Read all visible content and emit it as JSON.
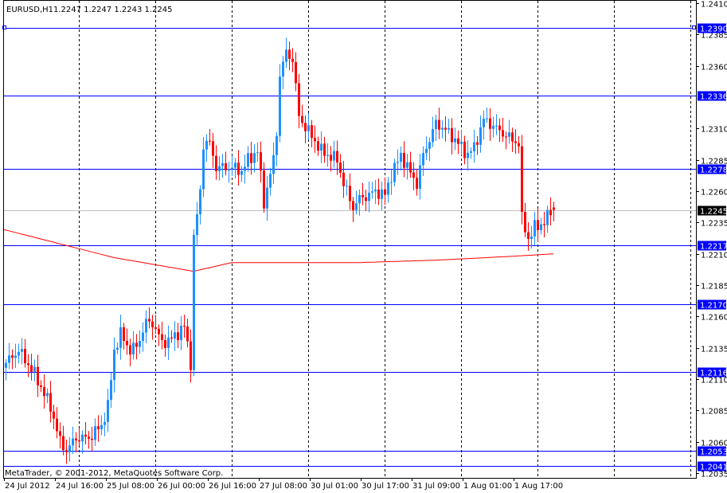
{
  "header": {
    "symbol_period": "EURUSD,H1",
    "quote": "1.2247 1.2247 1.2243 1.2245"
  },
  "copyright": "MetaTrader, © 2001-2012, MetaQuotes Software Corp.",
  "colors": {
    "bull": "#1e90ff",
    "bear": "#ff0000",
    "level_line": "#0000ff",
    "level_label_bg": "#0000ff",
    "current_line": "#c0c0c0",
    "current_label_bg": "#000000",
    "ma": "#ff0000",
    "grid": "#000000"
  },
  "chart_data": {
    "type": "candlestick",
    "title": "EURUSD,H1",
    "ylim": [
      1.2035,
      1.241
    ],
    "price_ticks": [
      "1.2410",
      "1.2385",
      "1.2360",
      "1.2310",
      "1.2285",
      "1.2260",
      "1.2235",
      "1.2210",
      "1.2185",
      "1.2160",
      "1.2135",
      "1.2110",
      "1.2085",
      "1.2060",
      "1.2035"
    ],
    "time_ticks": [
      {
        "bar": 0,
        "label": "24 Jul 2012"
      },
      {
        "bar": 16,
        "label": "24 Jul 16:00"
      },
      {
        "bar": 32,
        "label": "25 Jul 08:00"
      },
      {
        "bar": 48,
        "label": "26 Jul 00:00"
      },
      {
        "bar": 64,
        "label": "26 Jul 16:00"
      },
      {
        "bar": 80,
        "label": "27 Jul 08:00"
      },
      {
        "bar": 96,
        "label": "30 Jul 01:00"
      },
      {
        "bar": 112,
        "label": "30 Jul 17:00"
      },
      {
        "bar": 128,
        "label": "31 Jul 09:00"
      },
      {
        "bar": 144,
        "label": "1 Aug 01:00"
      },
      {
        "bar": 160,
        "label": "1 Aug 17:00"
      }
    ],
    "bar_count": 173,
    "close_path": [
      [
        0,
        1.2123
      ],
      [
        4,
        1.2133
      ],
      [
        9,
        1.2114
      ],
      [
        14,
        1.2088
      ],
      [
        17,
        1.206
      ],
      [
        19,
        1.2053
      ],
      [
        22,
        1.2063
      ],
      [
        26,
        1.2063
      ],
      [
        30,
        1.2073
      ],
      [
        32,
        1.2088
      ],
      [
        34,
        1.2133
      ],
      [
        36,
        1.2146
      ],
      [
        39,
        1.2133
      ],
      [
        41,
        1.2136
      ],
      [
        44,
        1.2155
      ],
      [
        46,
        1.2155
      ],
      [
        49,
        1.2139
      ],
      [
        52,
        1.2142
      ],
      [
        56,
        1.2152
      ],
      [
        58,
        1.2123
      ],
      [
        59,
        1.2222
      ],
      [
        61,
        1.226
      ],
      [
        62,
        1.2298
      ],
      [
        64,
        1.2298
      ],
      [
        66,
        1.2279
      ],
      [
        71,
        1.2279
      ],
      [
        74,
        1.2276
      ],
      [
        76,
        1.2285
      ],
      [
        79,
        1.2292
      ],
      [
        81,
        1.2251
      ],
      [
        84,
        1.2285
      ],
      [
        85,
        1.2308
      ],
      [
        86,
        1.2352
      ],
      [
        88,
        1.2371
      ],
      [
        90,
        1.2365
      ],
      [
        92,
        1.232
      ],
      [
        94,
        1.2311
      ],
      [
        96,
        1.2304
      ],
      [
        99,
        1.2292
      ],
      [
        101,
        1.2289
      ],
      [
        104,
        1.2285
      ],
      [
        106,
        1.2266
      ],
      [
        109,
        1.2247
      ],
      [
        111,
        1.2254
      ],
      [
        114,
        1.2257
      ],
      [
        116,
        1.226
      ],
      [
        119,
        1.2257
      ],
      [
        121,
        1.2273
      ],
      [
        124,
        1.2289
      ],
      [
        126,
        1.2279
      ],
      [
        129,
        1.2266
      ],
      [
        131,
        1.2289
      ],
      [
        135,
        1.2314
      ],
      [
        137,
        1.2311
      ],
      [
        140,
        1.2304
      ],
      [
        142,
        1.2298
      ],
      [
        145,
        1.2289
      ],
      [
        147,
        1.2295
      ],
      [
        150,
        1.2317
      ],
      [
        152,
        1.2314
      ],
      [
        155,
        1.2308
      ],
      [
        159,
        1.2301
      ],
      [
        161,
        1.2298
      ],
      [
        162,
        1.2238
      ],
      [
        164,
        1.2222
      ],
      [
        166,
        1.2231
      ],
      [
        169,
        1.2235
      ],
      [
        171,
        1.2244
      ],
      [
        172,
        1.2245
      ]
    ],
    "moving_average_path": [
      [
        0,
        1.2229
      ],
      [
        34,
        1.2207
      ],
      [
        59,
        1.2196
      ],
      [
        71,
        1.2203
      ],
      [
        86,
        1.2203
      ],
      [
        111,
        1.2203
      ],
      [
        136,
        1.2205
      ],
      [
        159,
        1.2208
      ],
      [
        172,
        1.221
      ]
    ],
    "levels": [
      {
        "price": "1.2390",
        "type": "level"
      },
      {
        "price": "1.2336",
        "type": "level"
      },
      {
        "price": "1.2278",
        "type": "level"
      },
      {
        "price": "1.2245",
        "type": "current"
      },
      {
        "price": "1.2217",
        "type": "level"
      },
      {
        "price": "1.2170",
        "type": "level"
      },
      {
        "price": "1.2116",
        "type": "level"
      },
      {
        "price": "1.2053",
        "type": "level"
      },
      {
        "price": "1.2041",
        "type": "level"
      }
    ]
  }
}
